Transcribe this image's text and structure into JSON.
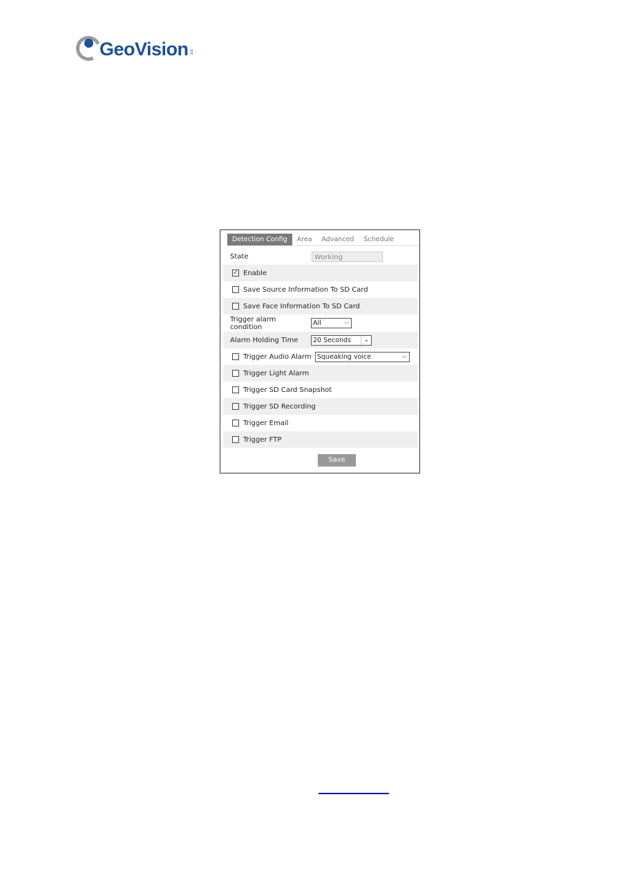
{
  "logo": {
    "text": "GeoVision",
    "suffix": "inc"
  },
  "tabs": [
    {
      "label": "Detection Config",
      "active": true
    },
    {
      "label": "Area"
    },
    {
      "label": "Advanced"
    },
    {
      "label": "Schedule"
    }
  ],
  "state": {
    "label": "State",
    "value": "Working"
  },
  "options": [
    {
      "label": "Enable",
      "checked": true
    },
    {
      "label": "Save Source Information To SD Card",
      "checked": false
    },
    {
      "label": "Save Face Information To SD Card",
      "checked": false
    }
  ],
  "trigger_condition": {
    "label": "Trigger alarm condition",
    "value": "All"
  },
  "holding_time": {
    "label": "Alarm Holding Time",
    "value": "20 Seconds"
  },
  "audio": {
    "label": "Trigger Audio Alarm",
    "checked": false,
    "value": "Squeaking voice"
  },
  "triggers": [
    {
      "label": "Trigger Light Alarm",
      "checked": false
    },
    {
      "label": "Trigger SD Card Snapshot",
      "checked": false
    },
    {
      "label": "Trigger SD Recording",
      "checked": false
    },
    {
      "label": "Trigger Email",
      "checked": false
    },
    {
      "label": "Trigger FTP",
      "checked": false
    }
  ],
  "save_label": "Save",
  "colors": {
    "brand": "#1b4f9c",
    "link": "#0000cc",
    "active_tab": "#7a7a7a"
  }
}
